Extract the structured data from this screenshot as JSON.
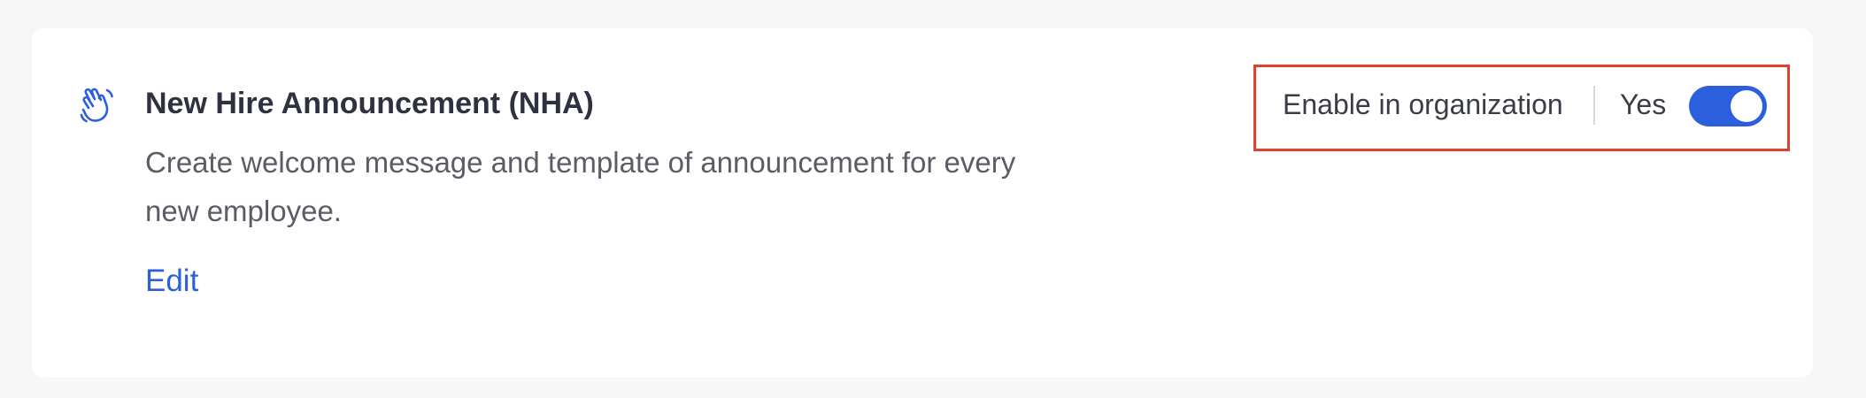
{
  "feature": {
    "icon": "waving-hand-icon",
    "title": "New Hire Announcement (NHA)",
    "description": "Create welcome message and template of announcement for every new employee.",
    "edit_label": "Edit"
  },
  "enable": {
    "label": "Enable in organization",
    "state_label": "Yes",
    "enabled": true
  },
  "colors": {
    "accent": "#2b5fde",
    "highlight_border": "#e0412f",
    "title_text": "#2f3140",
    "body_text": "#5a5c66",
    "background": "#f7f7f7",
    "card": "#ffffff"
  }
}
